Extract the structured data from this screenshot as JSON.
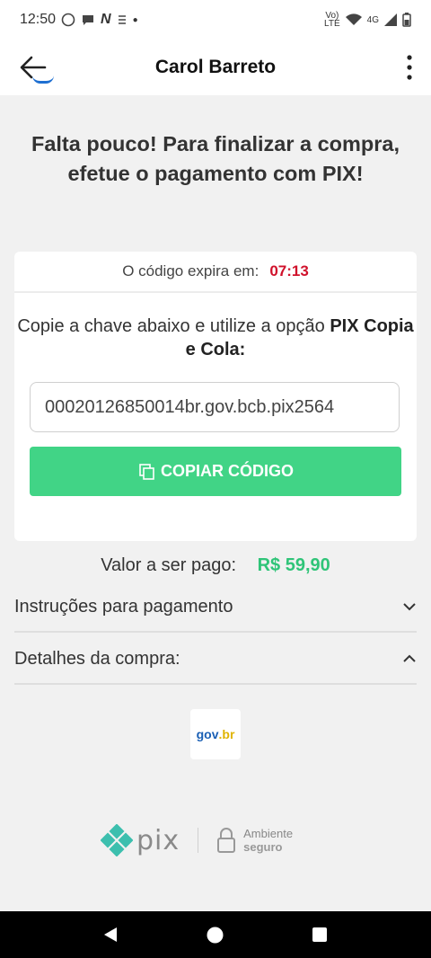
{
  "status": {
    "time": "12:50",
    "network": "4G"
  },
  "appbar": {
    "title": "Carol Barreto"
  },
  "headline": "Falta pouco! Para finalizar a compra, efetue o pagamento com PIX!",
  "card": {
    "expiry_label": "O código expira em:",
    "expiry_time": "07:13",
    "instruction_prefix": "Copie a chave abaixo e utilize a opção",
    "instruction_bold": "PIX Copia e Cola:",
    "pix_code": "00020126850014br.gov.bcb.pix2564",
    "copy_label": "COPIAR CÓDIGO"
  },
  "payment": {
    "label": "Valor a ser pago:",
    "amount": "R$ 59,90"
  },
  "accordions": {
    "instructions": "Instruções para pagamento",
    "details": "Detalhes da compra:"
  },
  "govbr": {
    "gov": "gov",
    "br": ".br"
  },
  "footer": {
    "pix": "pix",
    "secure_line1": "Ambiente",
    "secure_line2": "seguro"
  },
  "colors": {
    "accent_green": "#41d486",
    "amount_green": "#2fc478",
    "timer_red": "#d0112b"
  }
}
